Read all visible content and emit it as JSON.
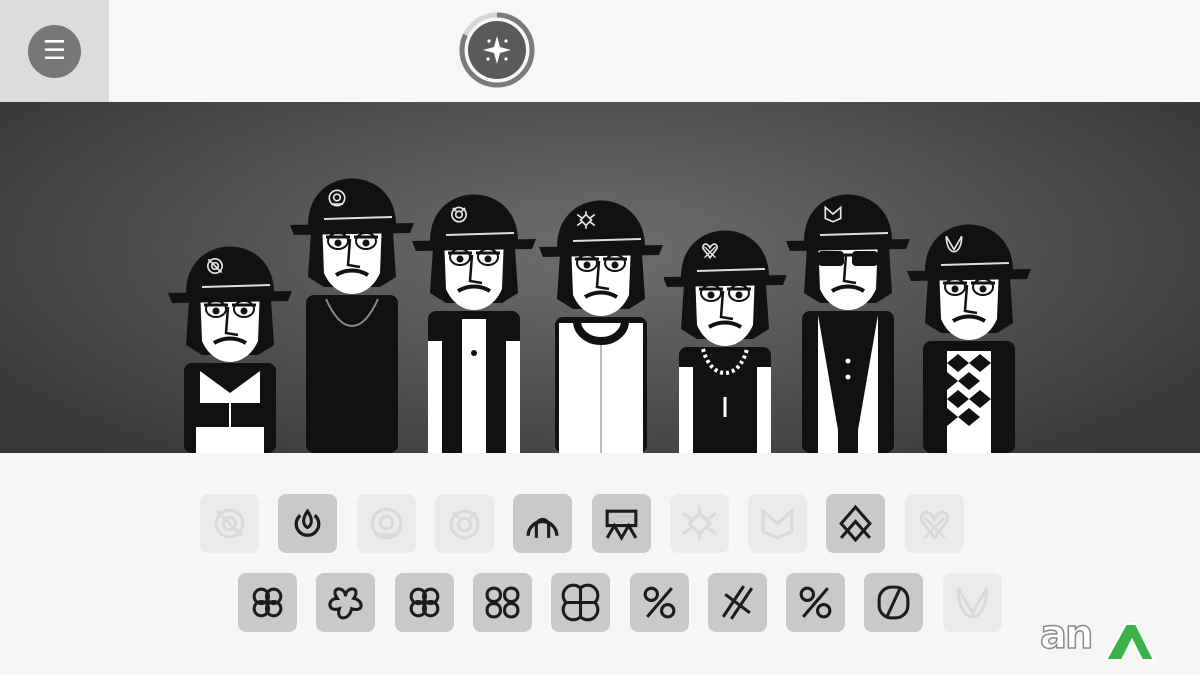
{
  "top_bar": {
    "menu_glyph": "☰",
    "menu_icon": "hamburger-icon",
    "center_icon": "sparkle-icon",
    "center_ring_progress": 0.82
  },
  "stage": {
    "performers": [
      {
        "cap_icon": "circle-slash-icon",
        "outfit": "zip-hoodie"
      },
      {
        "cap_icon": "at-circle-icon",
        "outfit": "black-hoodie"
      },
      {
        "cap_icon": "target-drop-icon",
        "outfit": "vest"
      },
      {
        "cap_icon": "spider-icon",
        "outfit": "headphones"
      },
      {
        "cap_icon": "heart-knot-icon",
        "outfit": "chain-tank"
      },
      {
        "cap_icon": "wing-m-icon",
        "outfit": "sunglasses-vest"
      },
      {
        "cap_icon": "leaf-v-icon",
        "outfit": "argyle"
      }
    ]
  },
  "sound_tray": {
    "row1": [
      {
        "icon": "circle-slash-icon",
        "state": "used"
      },
      {
        "icon": "power-drop-icon",
        "state": "available"
      },
      {
        "icon": "at-circle-icon",
        "state": "used"
      },
      {
        "icon": "target-drop-icon",
        "state": "used"
      },
      {
        "icon": "arch-circle-icon",
        "state": "available"
      },
      {
        "icon": "flag-zigzag-icon",
        "state": "available"
      },
      {
        "icon": "spider-icon",
        "state": "used"
      },
      {
        "icon": "wing-m-icon",
        "state": "used"
      },
      {
        "icon": "diamond-knot-icon",
        "state": "available"
      },
      {
        "icon": "heart-knot-icon",
        "state": "used"
      }
    ],
    "row2": [
      {
        "icon": "clover-icon",
        "state": "available"
      },
      {
        "icon": "quatrefoil-icon",
        "state": "available"
      },
      {
        "icon": "clover-icon",
        "state": "available"
      },
      {
        "icon": "double-loop-icon",
        "state": "available"
      },
      {
        "icon": "grid-clover-icon",
        "state": "available"
      },
      {
        "icon": "percent-slash-icon",
        "state": "available"
      },
      {
        "icon": "double-slash-icon",
        "state": "available"
      },
      {
        "icon": "percent-slash-icon",
        "state": "available"
      },
      {
        "icon": "pill-slash-icon",
        "state": "available"
      },
      {
        "icon": "leaf-v-icon",
        "state": "used"
      }
    ]
  },
  "watermark": {
    "text": "an",
    "logo_icon": "green-a-logo-icon"
  },
  "colors": {
    "stage_dark": "#383636",
    "slot_available": "#c9c9c9",
    "slot_used": "#ebebeb",
    "watermark_green": "#3bb34a"
  }
}
